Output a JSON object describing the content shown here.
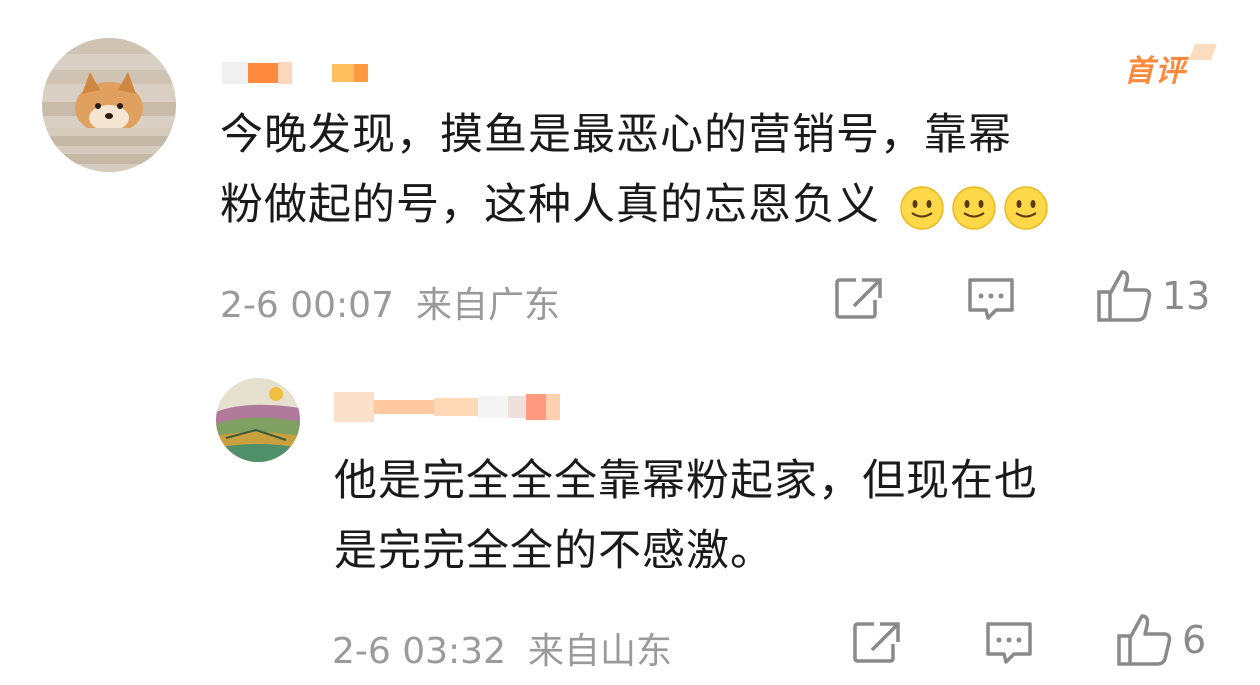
{
  "comments": [
    {
      "badge": "首评",
      "text_lines": [
        "今晚发现，摸鱼是最恶心的营销号，靠幂",
        "粉做起的号，这种人真的忘恩负义"
      ],
      "emoji": [
        "smile-emoji",
        "smile-emoji",
        "smile-emoji"
      ],
      "time": "2-6 00:07",
      "location": "来自广东",
      "likes": "13"
    },
    {
      "text_lines": [
        "他是完全全全靠幂粉起家，但现在也",
        "是完完全全的不感激。"
      ],
      "time": "2-6 03:32",
      "location": "来自山东",
      "likes": "6"
    }
  ],
  "icons": {
    "share": "share-icon",
    "comment": "comment-icon",
    "like": "thumbs-up-icon"
  },
  "colors": {
    "badge": "#ff8a3d",
    "meta_text": "#9a9a9a",
    "icon": "#8a8a8a"
  }
}
